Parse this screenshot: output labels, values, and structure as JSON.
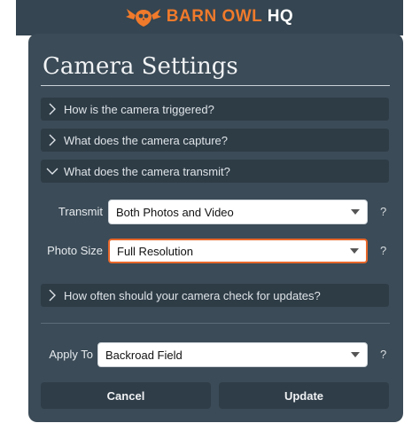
{
  "brand": {
    "name": "BARN OWL",
    "suffix": "HQ",
    "accent": "#f07a2b",
    "logo_icon": "owl-icon"
  },
  "dialog": {
    "title": "Camera Settings",
    "sections": [
      {
        "label": "How is the camera triggered?",
        "expanded": false
      },
      {
        "label": "What does the camera capture?",
        "expanded": false
      },
      {
        "label": "What does the camera transmit?",
        "expanded": true
      },
      {
        "label": "How often should your camera check for updates?",
        "expanded": false
      }
    ],
    "transmit": {
      "label": "Transmit",
      "value": "Both Photos and Video",
      "help": "?"
    },
    "photo_size": {
      "label": "Photo Size",
      "value": "Full Resolution",
      "help": "?"
    },
    "apply_to": {
      "label": "Apply To",
      "value": "Backroad Field",
      "help": "?"
    },
    "cancel_label": "Cancel",
    "update_label": "Update"
  },
  "colors": {
    "panel": "#3b4b57",
    "section": "#2e3c46",
    "focus_border": "#e8672a"
  }
}
